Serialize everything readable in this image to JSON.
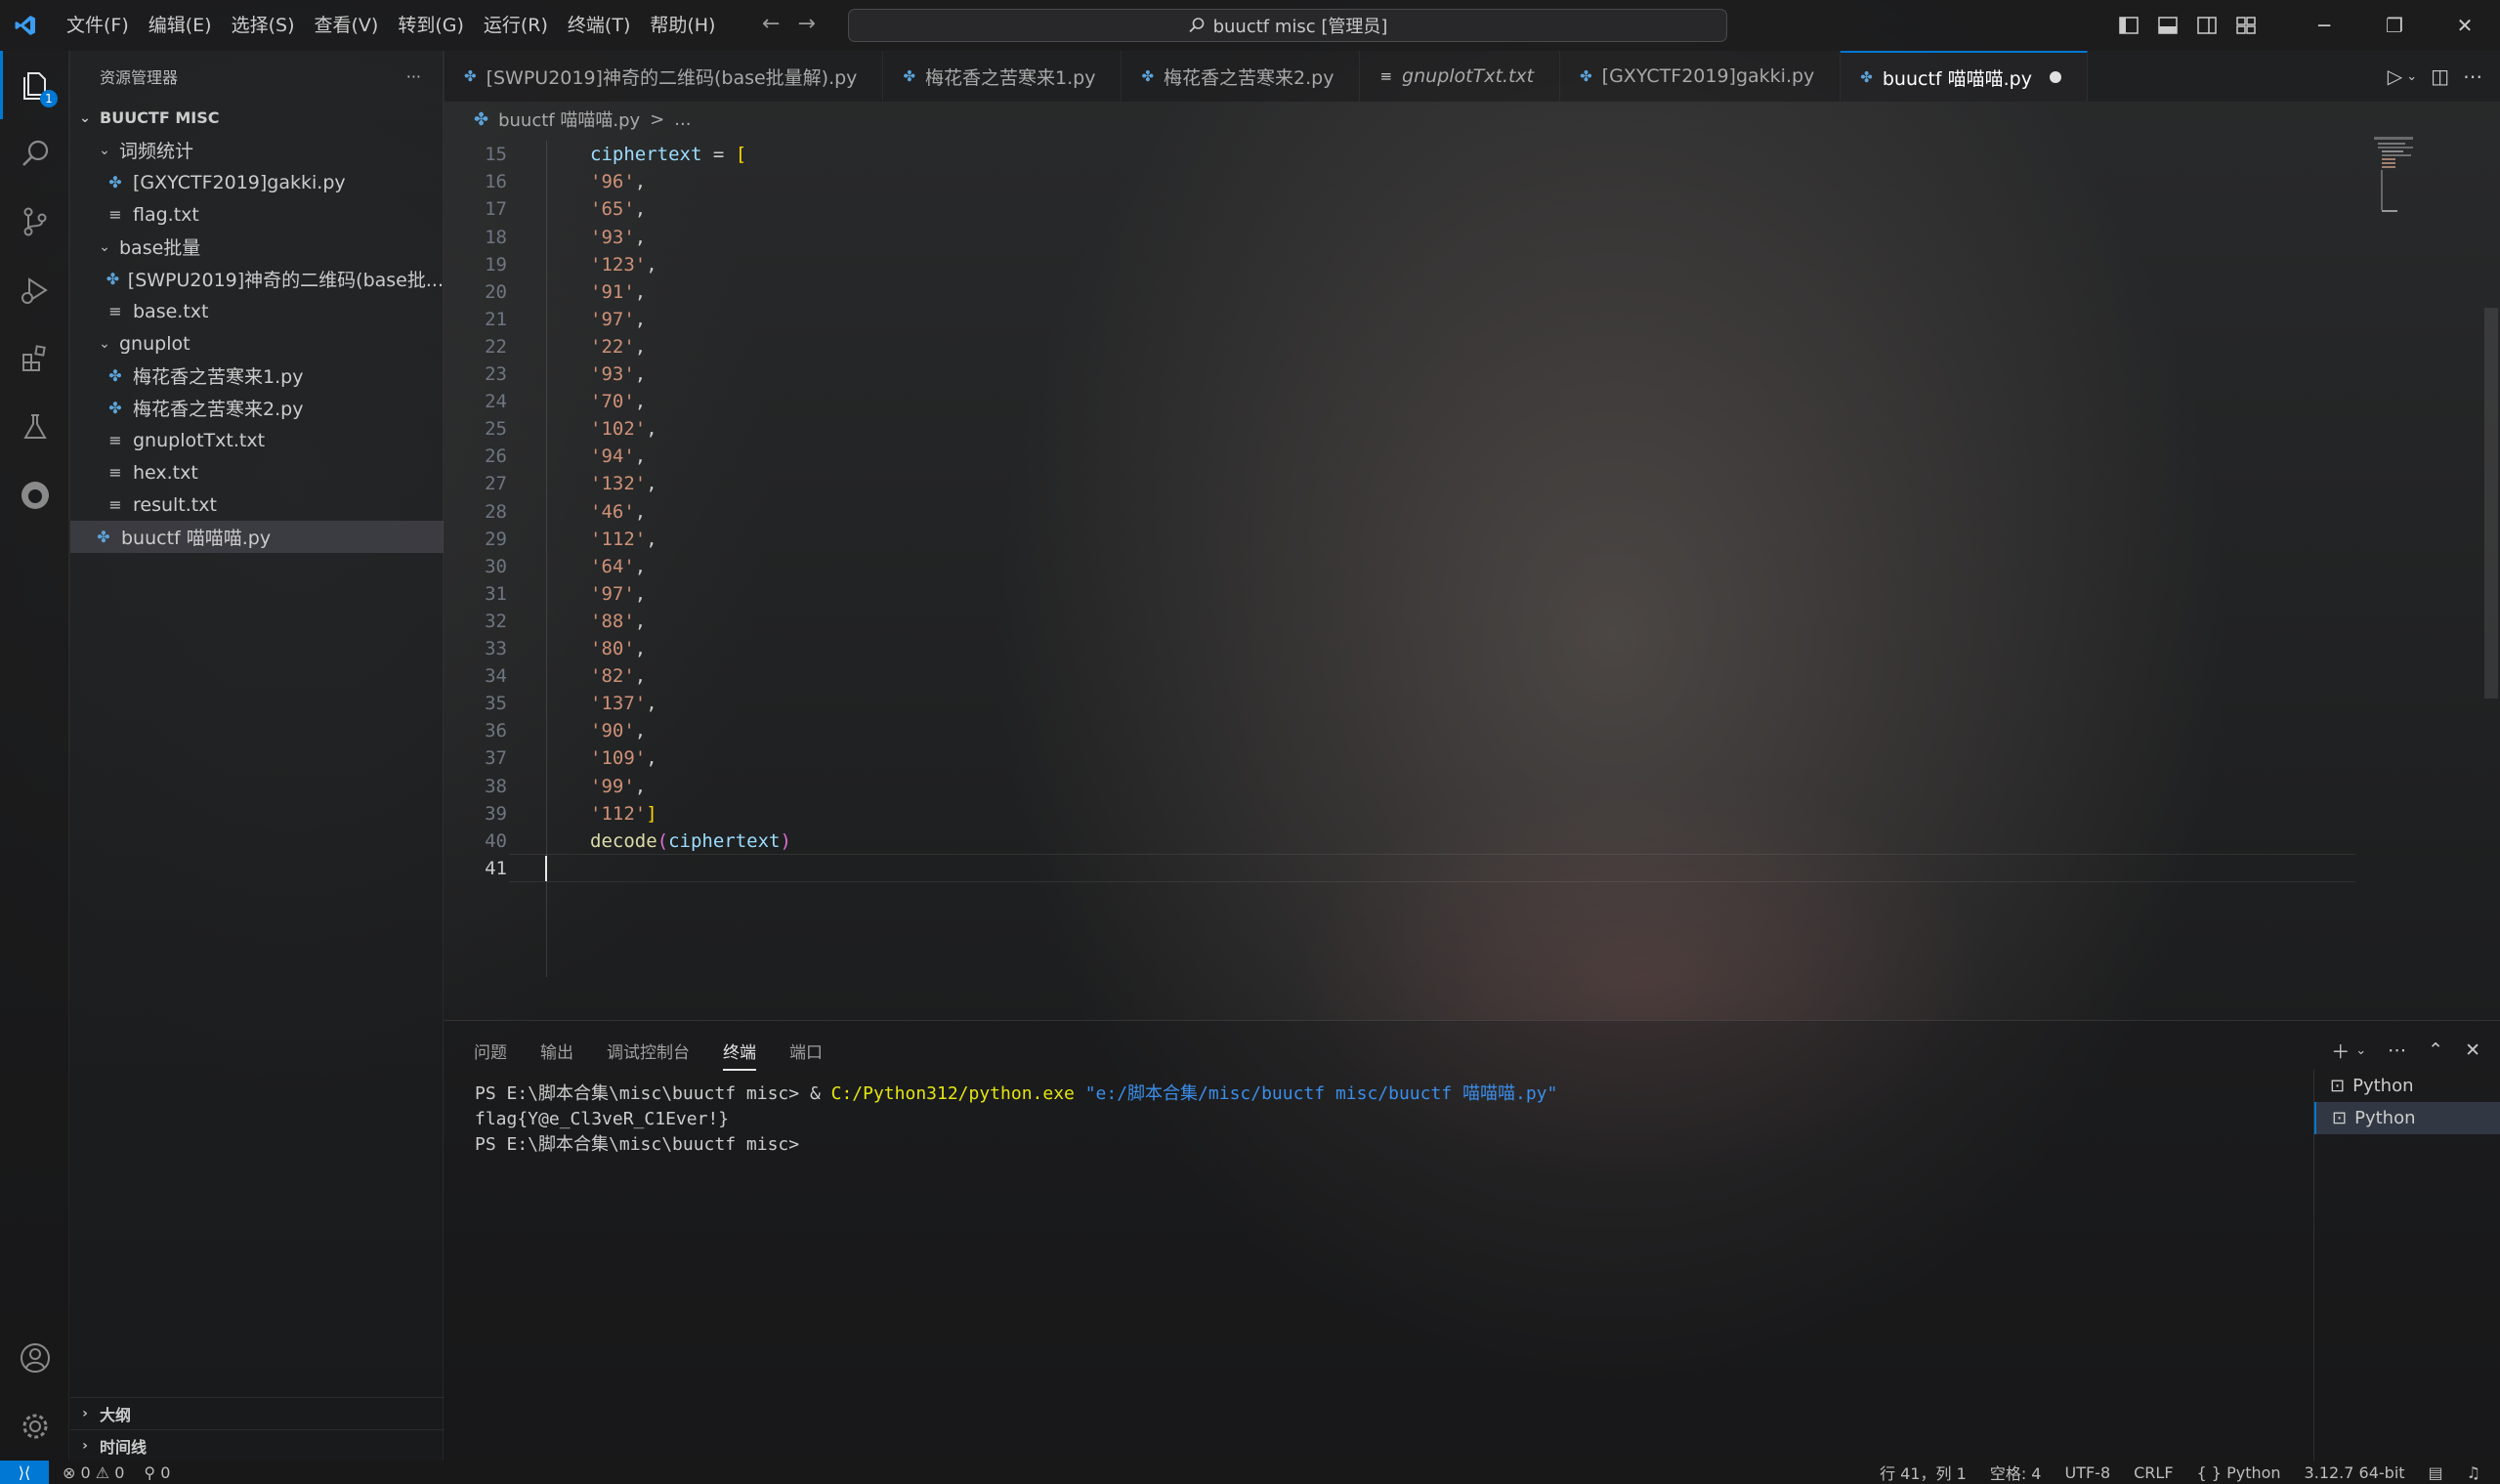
{
  "menu": [
    "文件(F)",
    "编辑(E)",
    "选择(S)",
    "查看(V)",
    "转到(G)",
    "运行(R)",
    "终端(T)",
    "帮助(H)"
  ],
  "search": {
    "label": "buuctf misc [管理员]"
  },
  "activity": {
    "badge": "1"
  },
  "explorer": {
    "title": "资源管理器",
    "more": "···",
    "root": "BUUCTF MISC",
    "rows": [
      {
        "label": "词频统计"
      },
      {
        "label": "[GXYCTF2019]gakki.py"
      },
      {
        "label": "flag.txt"
      },
      {
        "label": "base批量"
      },
      {
        "label": "[SWPU2019]神奇的二维码(base批..."
      },
      {
        "label": "base.txt"
      },
      {
        "label": "gnuplot"
      },
      {
        "label": "梅花香之苦寒来1.py"
      },
      {
        "label": "梅花香之苦寒来2.py"
      },
      {
        "label": "gnuplotTxt.txt"
      },
      {
        "label": "hex.txt"
      },
      {
        "label": "result.txt"
      },
      {
        "label": "buuctf 喵喵喵.py"
      }
    ],
    "outline": "大纲",
    "timeline": "时间线"
  },
  "tabs": [
    {
      "label": "[SWPU2019]神奇的二维码(base批量解).py"
    },
    {
      "label": "梅花香之苦寒来1.py"
    },
    {
      "label": "梅花香之苦寒来2.py"
    },
    {
      "label": "gnuplotTxt.txt"
    },
    {
      "label": "[GXYCTF2019]gakki.py"
    },
    {
      "label": "buuctf 喵喵喵.py"
    }
  ],
  "breadcrumb": {
    "file": "buuctf 喵喵喵.py",
    "sep": ">",
    "more": "..."
  },
  "editor": {
    "line_numbers": [
      "15",
      "16",
      "17",
      "18",
      "19",
      "20",
      "21",
      "22",
      "23",
      "24",
      "25",
      "26",
      "27",
      "28",
      "29",
      "30",
      "31",
      "32",
      "33",
      "34",
      "35",
      "36",
      "37",
      "38",
      "39",
      "40",
      "41"
    ],
    "first_line": {
      "ident": "ciphertext",
      "op": " = ",
      "open": "["
    },
    "strings": [
      "'96'",
      "'65'",
      "'93'",
      "'123'",
      "'91'",
      "'97'",
      "'22'",
      "'93'",
      "'70'",
      "'102'",
      "'94'",
      "'132'",
      "'46'",
      "'112'",
      "'64'",
      "'97'",
      "'88'",
      "'80'",
      "'82'",
      "'137'",
      "'90'",
      "'109'",
      "'99'"
    ],
    "last_string": "'112'",
    "close": "]",
    "comma": ",",
    "call": {
      "fn": "decode",
      "open": "(",
      "arg": "ciphertext",
      "close": ")"
    }
  },
  "panel": {
    "tabs": [
      "问题",
      "输出",
      "调试控制台",
      "终端",
      "端口"
    ],
    "terminal": {
      "prompt1": "PS E:\\脚本合集\\misc\\buuctf misc> ",
      "amp": "& ",
      "exe": "C:/Python312/python.exe",
      "script": " \"e:/脚本合集/misc/buuctf misc/buuctf 喵喵喵.py\"",
      "output": "flag{Y@e_Cl3veR_C1Ever!}",
      "prompt2": "PS E:\\脚本合集\\misc\\buuctf misc>"
    },
    "instances": [
      "Python",
      "Python"
    ]
  },
  "status": {
    "errors": "0",
    "warnings": "0",
    "ports": "0",
    "position": "行 41，列 1",
    "spaces": "空格: 4",
    "encoding": "UTF-8",
    "eol": "CRLF",
    "language": "Python",
    "interpreter": "3.12.7 64-bit"
  },
  "colors": {
    "accent": "#0078d4",
    "string": "#ce9178",
    "identifier": "#9cdcfe",
    "function": "#dcdcaa"
  }
}
